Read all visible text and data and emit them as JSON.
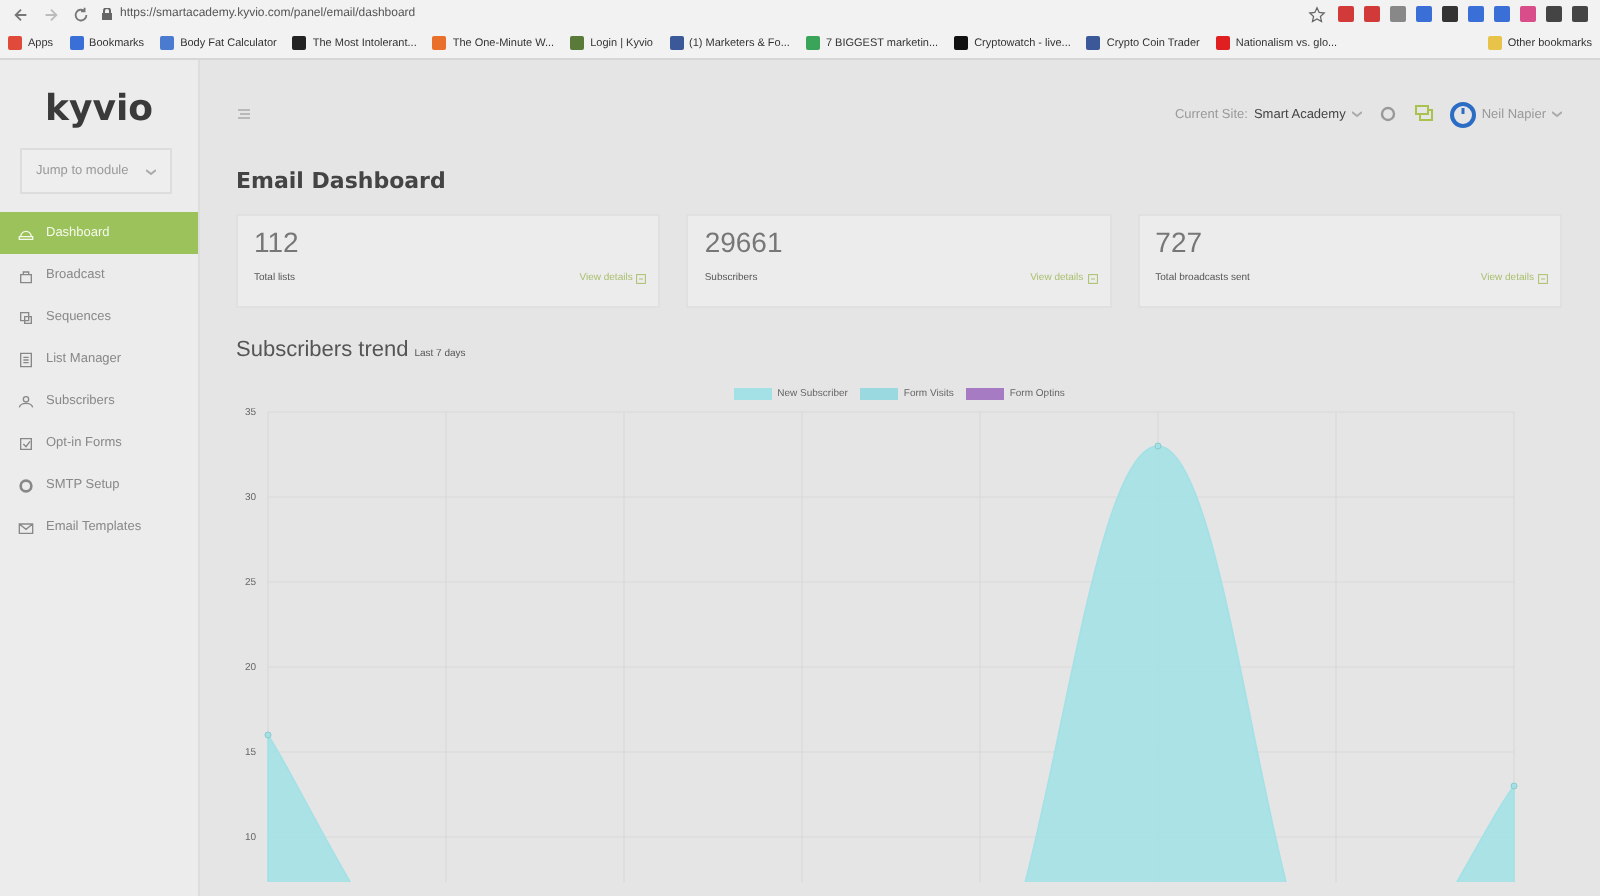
{
  "browser": {
    "url": "https://smartacademy.kyvio.com/panel/email/dashboard",
    "bookmarks": [
      {
        "label": "Apps",
        "color": "#e04a3a"
      },
      {
        "label": "Bookmarks",
        "color": "#3b6fd8"
      },
      {
        "label": "Body Fat Calculator",
        "color": "#4a7bd0"
      },
      {
        "label": "The Most Intolerant...",
        "color": "#222222"
      },
      {
        "label": "The One-Minute W...",
        "color": "#e8702a"
      },
      {
        "label": "Login | Kyvio",
        "color": "#5a7a3a"
      },
      {
        "label": "(1) Marketers & Fo...",
        "color": "#3b5998"
      },
      {
        "label": "7 BIGGEST marketin...",
        "color": "#3aa55a"
      },
      {
        "label": "Cryptowatch - live...",
        "color": "#111111"
      },
      {
        "label": "Crypto Coin Trader",
        "color": "#3b5998"
      },
      {
        "label": "Nationalism vs. glo...",
        "color": "#e02020"
      }
    ],
    "other_bookmarks": "Other bookmarks"
  },
  "sidebar": {
    "logo": "kyvio",
    "jump_select": "Jump to module",
    "items": [
      {
        "label": "Dashboard",
        "selected": true
      },
      {
        "label": "Broadcast",
        "selected": false
      },
      {
        "label": "Sequences",
        "selected": false
      },
      {
        "label": "List Manager",
        "selected": false
      },
      {
        "label": "Subscribers",
        "selected": false
      },
      {
        "label": "Opt-in Forms",
        "selected": false
      },
      {
        "label": "SMTP Setup",
        "selected": false
      },
      {
        "label": "Email Templates",
        "selected": false
      }
    ]
  },
  "header": {
    "current_site_label": "Current Site:",
    "current_site": "Smart Academy",
    "user": "Neil Napier"
  },
  "page_title": "Email Dashboard",
  "stats": [
    {
      "value": "112",
      "label": "Total lists",
      "link": "View details"
    },
    {
      "value": "29661",
      "label": "Subscribers",
      "link": "View details"
    },
    {
      "value": "727",
      "label": "Total broadcasts sent",
      "link": "View details"
    }
  ],
  "trend": {
    "title": "Subscribers trend",
    "subtitle": "Last 7 days",
    "chart_data": {
      "type": "area",
      "series": [
        {
          "name": "New Subscriber",
          "color": "#a3e1e6",
          "values": [
            16,
            0,
            0,
            0,
            0,
            33,
            0,
            13
          ]
        },
        {
          "name": "Form Visits",
          "color": "#9ad9e0",
          "values": [
            null,
            null,
            null,
            null,
            null,
            null,
            null,
            null
          ]
        },
        {
          "name": "Form Optins",
          "color": "#a77bc4",
          "values": [
            null,
            null,
            null,
            null,
            null,
            null,
            null,
            null
          ]
        }
      ],
      "ylim": [
        0,
        35
      ],
      "yticks": [
        10,
        15,
        20,
        25,
        30,
        35
      ],
      "grid": true
    }
  }
}
